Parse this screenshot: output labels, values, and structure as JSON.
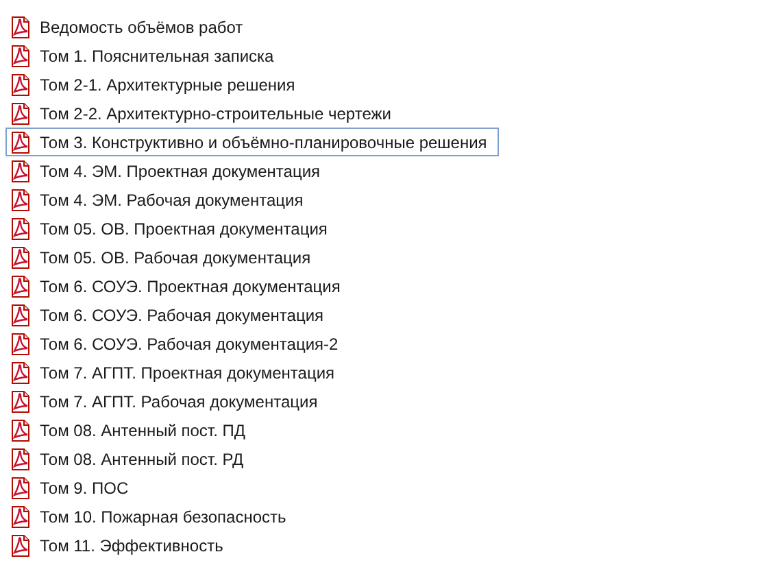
{
  "files": [
    {
      "name": "Ведомость объёмов работ",
      "focused": false
    },
    {
      "name": "Том 1. Пояснительная записка",
      "focused": false
    },
    {
      "name": "Том 2-1. Архитектурные решения",
      "focused": false
    },
    {
      "name": "Том 2-2. Архитектурно-строительные чертежи",
      "focused": false
    },
    {
      "name": "Том 3. Конструктивно и объёмно-планировочные решения",
      "focused": true
    },
    {
      "name": "Том 4. ЭМ. Проектная документация",
      "focused": false
    },
    {
      "name": "Том 4. ЭМ. Рабочая документация",
      "focused": false
    },
    {
      "name": "Том 05. ОВ. Проектная документация",
      "focused": false
    },
    {
      "name": "Том 05. ОВ. Рабочая документация",
      "focused": false
    },
    {
      "name": "Том 6. СОУЭ. Проектная документация",
      "focused": false
    },
    {
      "name": "Том 6. СОУЭ. Рабочая документация",
      "focused": false
    },
    {
      "name": "Том 6. СОУЭ. Рабочая документация-2",
      "focused": false
    },
    {
      "name": "Том 7. АГПТ. Проектная документация",
      "focused": false
    },
    {
      "name": "Том 7. АГПТ. Рабочая документация",
      "focused": false
    },
    {
      "name": "Том 08. Антенный пост. ПД",
      "focused": false
    },
    {
      "name": "Том 08. Антенный пост. РД",
      "focused": false
    },
    {
      "name": "Том 9. ПОС",
      "focused": false
    },
    {
      "name": "Том 10. Пожарная безопасность",
      "focused": false
    },
    {
      "name": "Том 11. Эффективность",
      "focused": false
    }
  ]
}
